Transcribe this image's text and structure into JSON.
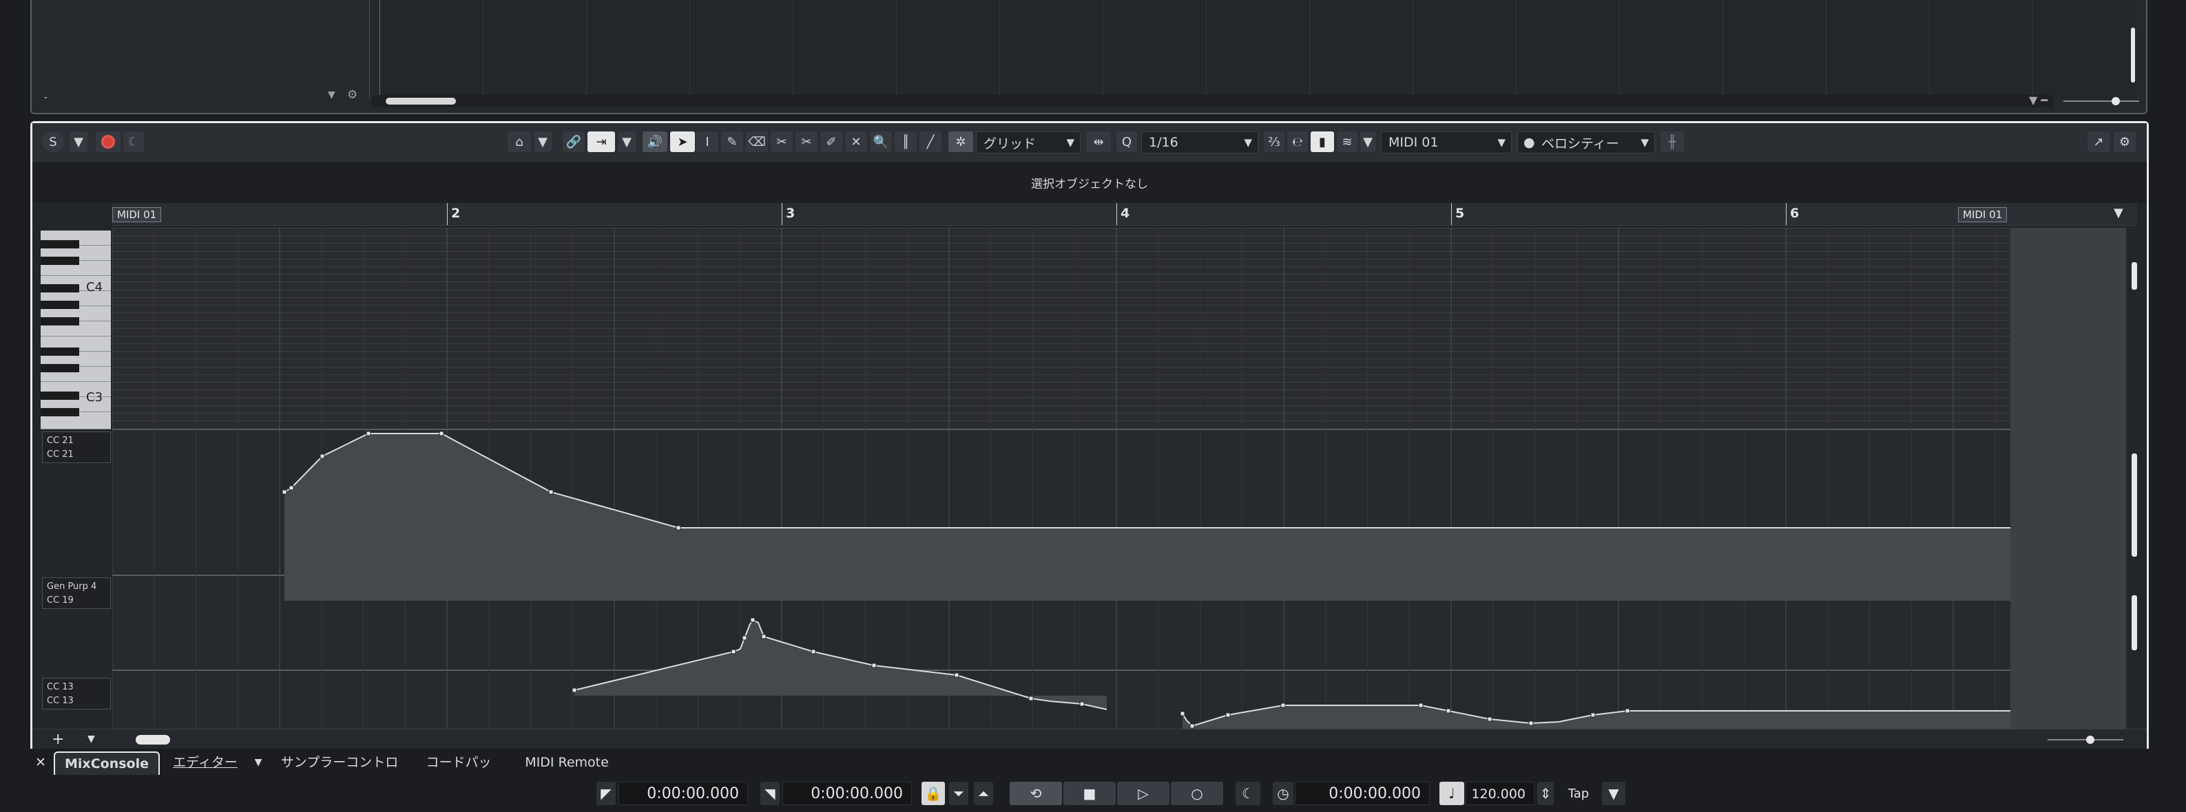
{
  "upper": {
    "row_text": "-"
  },
  "toolbar": {
    "solo_icon": "S",
    "grid_type": "グリッド",
    "quantize_label": "Q",
    "quantize_value": "1/16",
    "track": "MIDI 01",
    "controller": "ベロシティー"
  },
  "info": {
    "status": "選択オブジェクトなし"
  },
  "ruler": {
    "bars": [
      "2",
      "3",
      "4",
      "5",
      "6"
    ],
    "event_start_label": "MIDI 01",
    "event_end_label": "MIDI 01"
  },
  "keyboard": {
    "c4": "C4",
    "c3": "C3"
  },
  "lanes": [
    {
      "line1": "CC 21",
      "line2": "CC 21"
    },
    {
      "line1": "Gen Purp 4",
      "line2": "CC 19"
    },
    {
      "line1": "CC 13",
      "line2": "CC 13"
    }
  ],
  "tabs": {
    "close": "✕",
    "mixconsole": "MixConsole",
    "editor": "エディター",
    "sampler": "サンプラーコントロール",
    "chordpad": "コードパッド",
    "midi_remote": "MIDI Remote"
  },
  "transport": {
    "left_locator": "0:00:00.000",
    "right_locator": "0:00:00.000",
    "time": "0:00:00.000",
    "tempo": "120.000",
    "tap": "Tap"
  },
  "colors": {
    "accent_record": "#d9423a",
    "panel": "#222529",
    "border_active": "#e9eaec"
  }
}
